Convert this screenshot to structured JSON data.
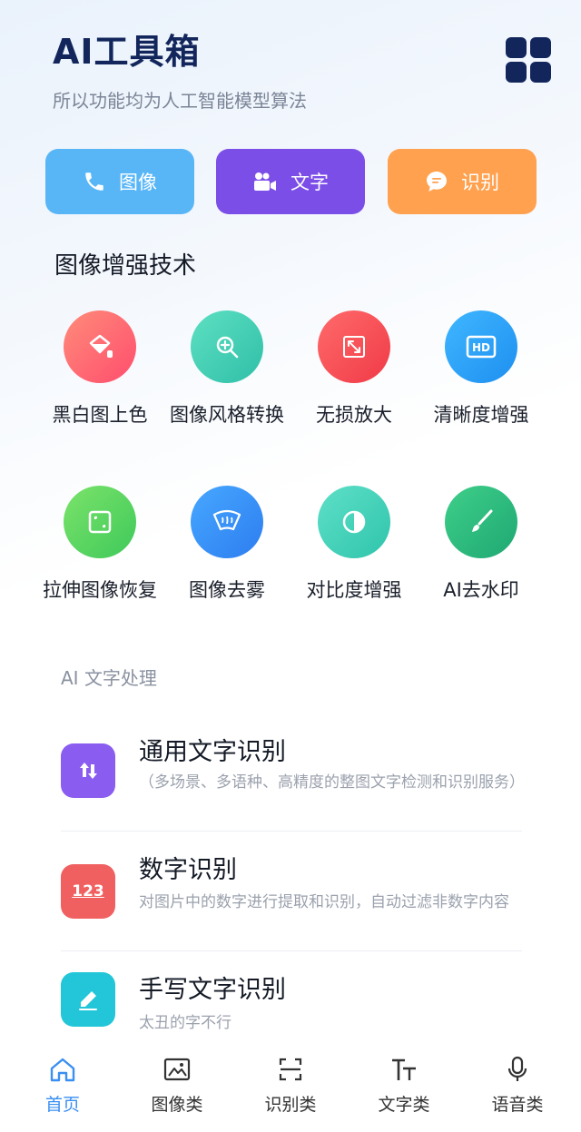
{
  "header": {
    "title": "AI工具箱",
    "subtitle": "所以功能均为人工智能模型算法"
  },
  "quick_actions": [
    {
      "label": "图像",
      "icon": "phone-icon",
      "color": "#58b6f7"
    },
    {
      "label": "文字",
      "icon": "video-camera-icon",
      "color": "#7c4ee8"
    },
    {
      "label": "识别",
      "icon": "chat-bubble-icon",
      "color": "#ffa14e"
    }
  ],
  "image_section": {
    "title": "图像增强技术",
    "tools": [
      {
        "label": "黑白图上色",
        "icon": "paint-bucket-icon"
      },
      {
        "label": "图像风格转换",
        "icon": "zoom-in-icon"
      },
      {
        "label": "无损放大",
        "icon": "expand-icon"
      },
      {
        "label": "清晰度增强",
        "icon": "hd-icon"
      },
      {
        "label": "拉伸图像恢复",
        "icon": "crop-frame-icon"
      },
      {
        "label": "图像去雾",
        "icon": "defog-icon"
      },
      {
        "label": "对比度增强",
        "icon": "contrast-icon"
      },
      {
        "label": "AI去水印",
        "icon": "brush-icon"
      }
    ]
  },
  "text_section": {
    "title": "AI 文字处理",
    "items": [
      {
        "title": "通用文字识别",
        "desc": "（多场景、多语种、高精度的整图文字检测和识别服务）",
        "icon": "sort-arrows-icon"
      },
      {
        "title": "数字识别",
        "desc": "对图片中的数字进行提取和识别，自动过滤非数字内容",
        "icon_text": "123",
        "icon": "number-icon"
      },
      {
        "title": "手写文字识别",
        "desc": "太丑的字不行",
        "icon": "pen-icon"
      }
    ]
  },
  "bottom_nav": [
    {
      "label": "首页",
      "icon": "home-icon",
      "active": true
    },
    {
      "label": "图像类",
      "icon": "image-icon",
      "active": false
    },
    {
      "label": "识别类",
      "icon": "scan-icon",
      "active": false
    },
    {
      "label": "文字类",
      "icon": "text-size-icon",
      "active": false
    },
    {
      "label": "语音类",
      "icon": "microphone-icon",
      "active": false
    }
  ],
  "colors": {
    "primary_dark": "#13265c",
    "nav_active": "#3a8ff2"
  }
}
